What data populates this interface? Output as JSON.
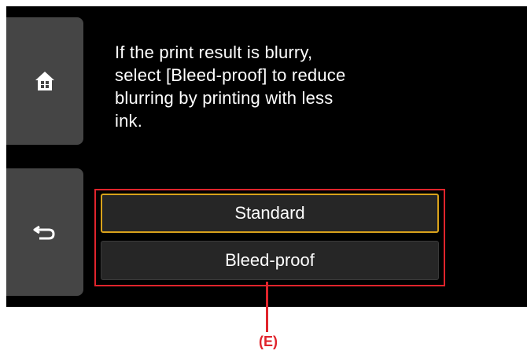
{
  "screen": {
    "message": "If the print result is blurry,\nselect [Bleed-proof] to reduce\nblurring by printing with less\nink.",
    "options": [
      {
        "label": "Standard",
        "selected": true
      },
      {
        "label": "Bleed-proof",
        "selected": false
      }
    ]
  },
  "icons": {
    "home": "home-icon",
    "back": "back-icon"
  },
  "callout": {
    "label": "(E)"
  },
  "colors": {
    "highlight": "#e0242c",
    "selection": "#d9a21b",
    "screen": "#000000",
    "button": "#454545"
  }
}
